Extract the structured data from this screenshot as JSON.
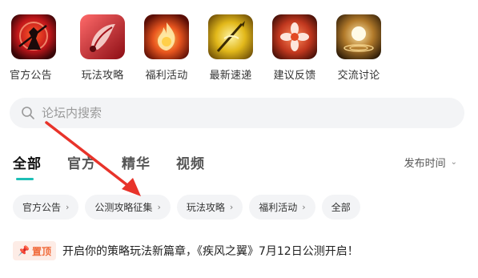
{
  "shortcuts": [
    {
      "label": "官方公告",
      "icon": "warrior-icon"
    },
    {
      "label": "玩法攻略",
      "icon": "scroll-icon"
    },
    {
      "label": "福利活动",
      "icon": "flame-icon"
    },
    {
      "label": "最新速递",
      "icon": "spear-icon"
    },
    {
      "label": "建议反馈",
      "icon": "flower-icon"
    },
    {
      "label": "交流讨论",
      "icon": "orb-icon"
    }
  ],
  "search": {
    "placeholder": "论坛内搜索"
  },
  "tabs": [
    {
      "label": "全部",
      "active": true
    },
    {
      "label": "官方",
      "active": false
    },
    {
      "label": "精华",
      "active": false
    },
    {
      "label": "视频",
      "active": false
    }
  ],
  "sort": {
    "label": "发布时间",
    "icon": "chevron-down-icon"
  },
  "chips": [
    {
      "label": "官方公告",
      "arrow": "›"
    },
    {
      "label": "公测攻略征集",
      "arrow": "›"
    },
    {
      "label": "玩法攻略",
      "arrow": "›"
    },
    {
      "label": "福利活动",
      "arrow": "›"
    },
    {
      "label": "全部",
      "arrow": ""
    }
  ],
  "post": {
    "badge": "置顶",
    "title": "开启你的策略玩法新篇章，《疾风之翼》7月12日公测开启！"
  },
  "colors": {
    "accent": "#1dbfb6",
    "pin": "#f06a3a",
    "annotation_arrow": "#e8332a"
  }
}
